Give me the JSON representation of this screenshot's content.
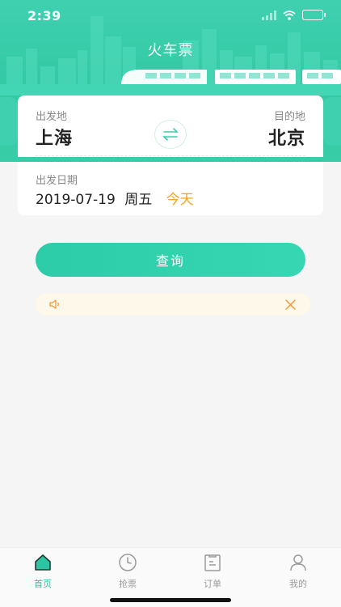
{
  "status_bar": {
    "time": "2:39"
  },
  "header": {
    "title": "火车票"
  },
  "route": {
    "from_label": "出发地",
    "from_city": "上海",
    "to_label": "目的地",
    "to_city": "北京"
  },
  "date": {
    "label": "出发日期",
    "value": "2019-07-19",
    "weekday": "周五",
    "relative": "今天"
  },
  "search_button": {
    "label": "查询"
  },
  "tabs": [
    {
      "label": "首页",
      "icon": "home-icon",
      "active": true
    },
    {
      "label": "抢票",
      "icon": "clock-icon",
      "active": false
    },
    {
      "label": "订单",
      "icon": "order-icon",
      "active": false
    },
    {
      "label": "我的",
      "icon": "user-icon",
      "active": false
    }
  ],
  "colors": {
    "brand": "#33c9a3",
    "accent_orange": "#f4a029",
    "notice_bg": "#fdf8ea"
  }
}
